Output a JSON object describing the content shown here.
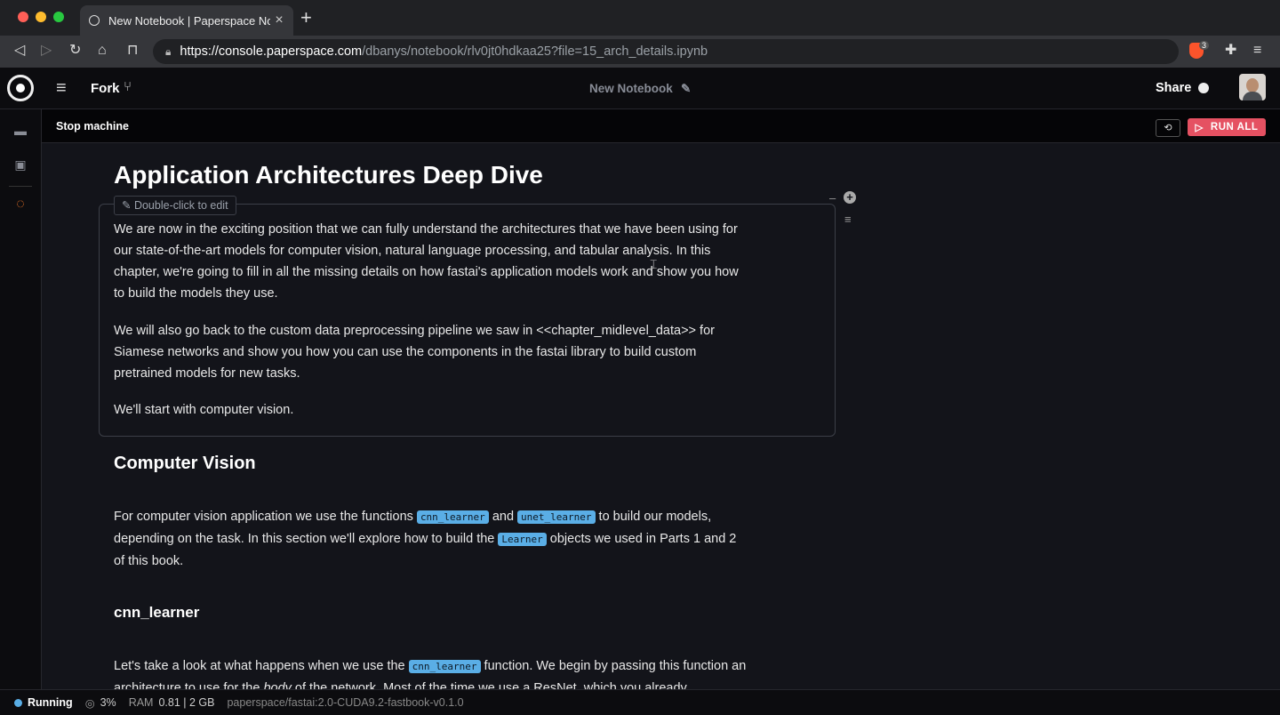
{
  "browser": {
    "tab_title": "New Notebook | Paperspace Notebook",
    "new_tab": "+",
    "url_host": "https://console.paperspace.com",
    "url_path": "/dbanys/notebook/rlv0jt0hdkaa25?file=15_arch_details.ipynb",
    "extension_badge": "3"
  },
  "appbar": {
    "fork_label": "Fork",
    "notebook_title": "New Notebook",
    "share_label": "Share"
  },
  "subbar": {
    "stop_label": "Stop machine",
    "run_all_label": "RUN ALL"
  },
  "content": {
    "title": "Application Architectures Deep Dive",
    "edit_hint": "Double-click to edit",
    "intro_p1": "We are now in the exciting position that we can fully understand the architectures that we have been using for our state-of-the-art models for computer vision, natural language processing, and tabular analysis. In this chapter, we're going to fill in all the missing details on how fastai's application models work and show you how to build the models they use.",
    "intro_p2": "We will also go back to the custom data preprocessing pipeline we saw in <<chapter_midlevel_data>> for Siamese networks and show you how you can use the components in the fastai library to build custom pretrained models for new tasks.",
    "intro_p3": "We'll start with computer vision.",
    "cv_heading": "Computer Vision",
    "cv_p_a": "For computer vision application we use the functions ",
    "cv_code1": "cnn_learner",
    "cv_p_b": " and ",
    "cv_code2": "unet_learner",
    "cv_p_c": " to build our models, depending on the task. In this section we'll explore how to build the ",
    "cv_code3": "Learner",
    "cv_p_d": " objects we used in Parts 1 and 2 of this book.",
    "cnn_heading": "cnn_learner",
    "cnn_p_a": "Let's take a look at what happens when we use the ",
    "cnn_code": "cnn_learner",
    "cnn_p_b": " function. We begin by passing this function an architecture to use for the ",
    "cnn_em": "body",
    "cnn_p_c": " of the network. Most of the time we use a ResNet, which you already"
  },
  "status": {
    "state": "Running",
    "cpu": "3%",
    "ram_label": "RAM",
    "ram_value": "0.81 | 2 GB",
    "container": "paperspace/fastai:2.0-CUDA9.2-fastbook-v0.1.0"
  },
  "colors": {
    "accent_blue": "#5aaee6",
    "run_all": "#e55162",
    "background": "#13141a"
  }
}
